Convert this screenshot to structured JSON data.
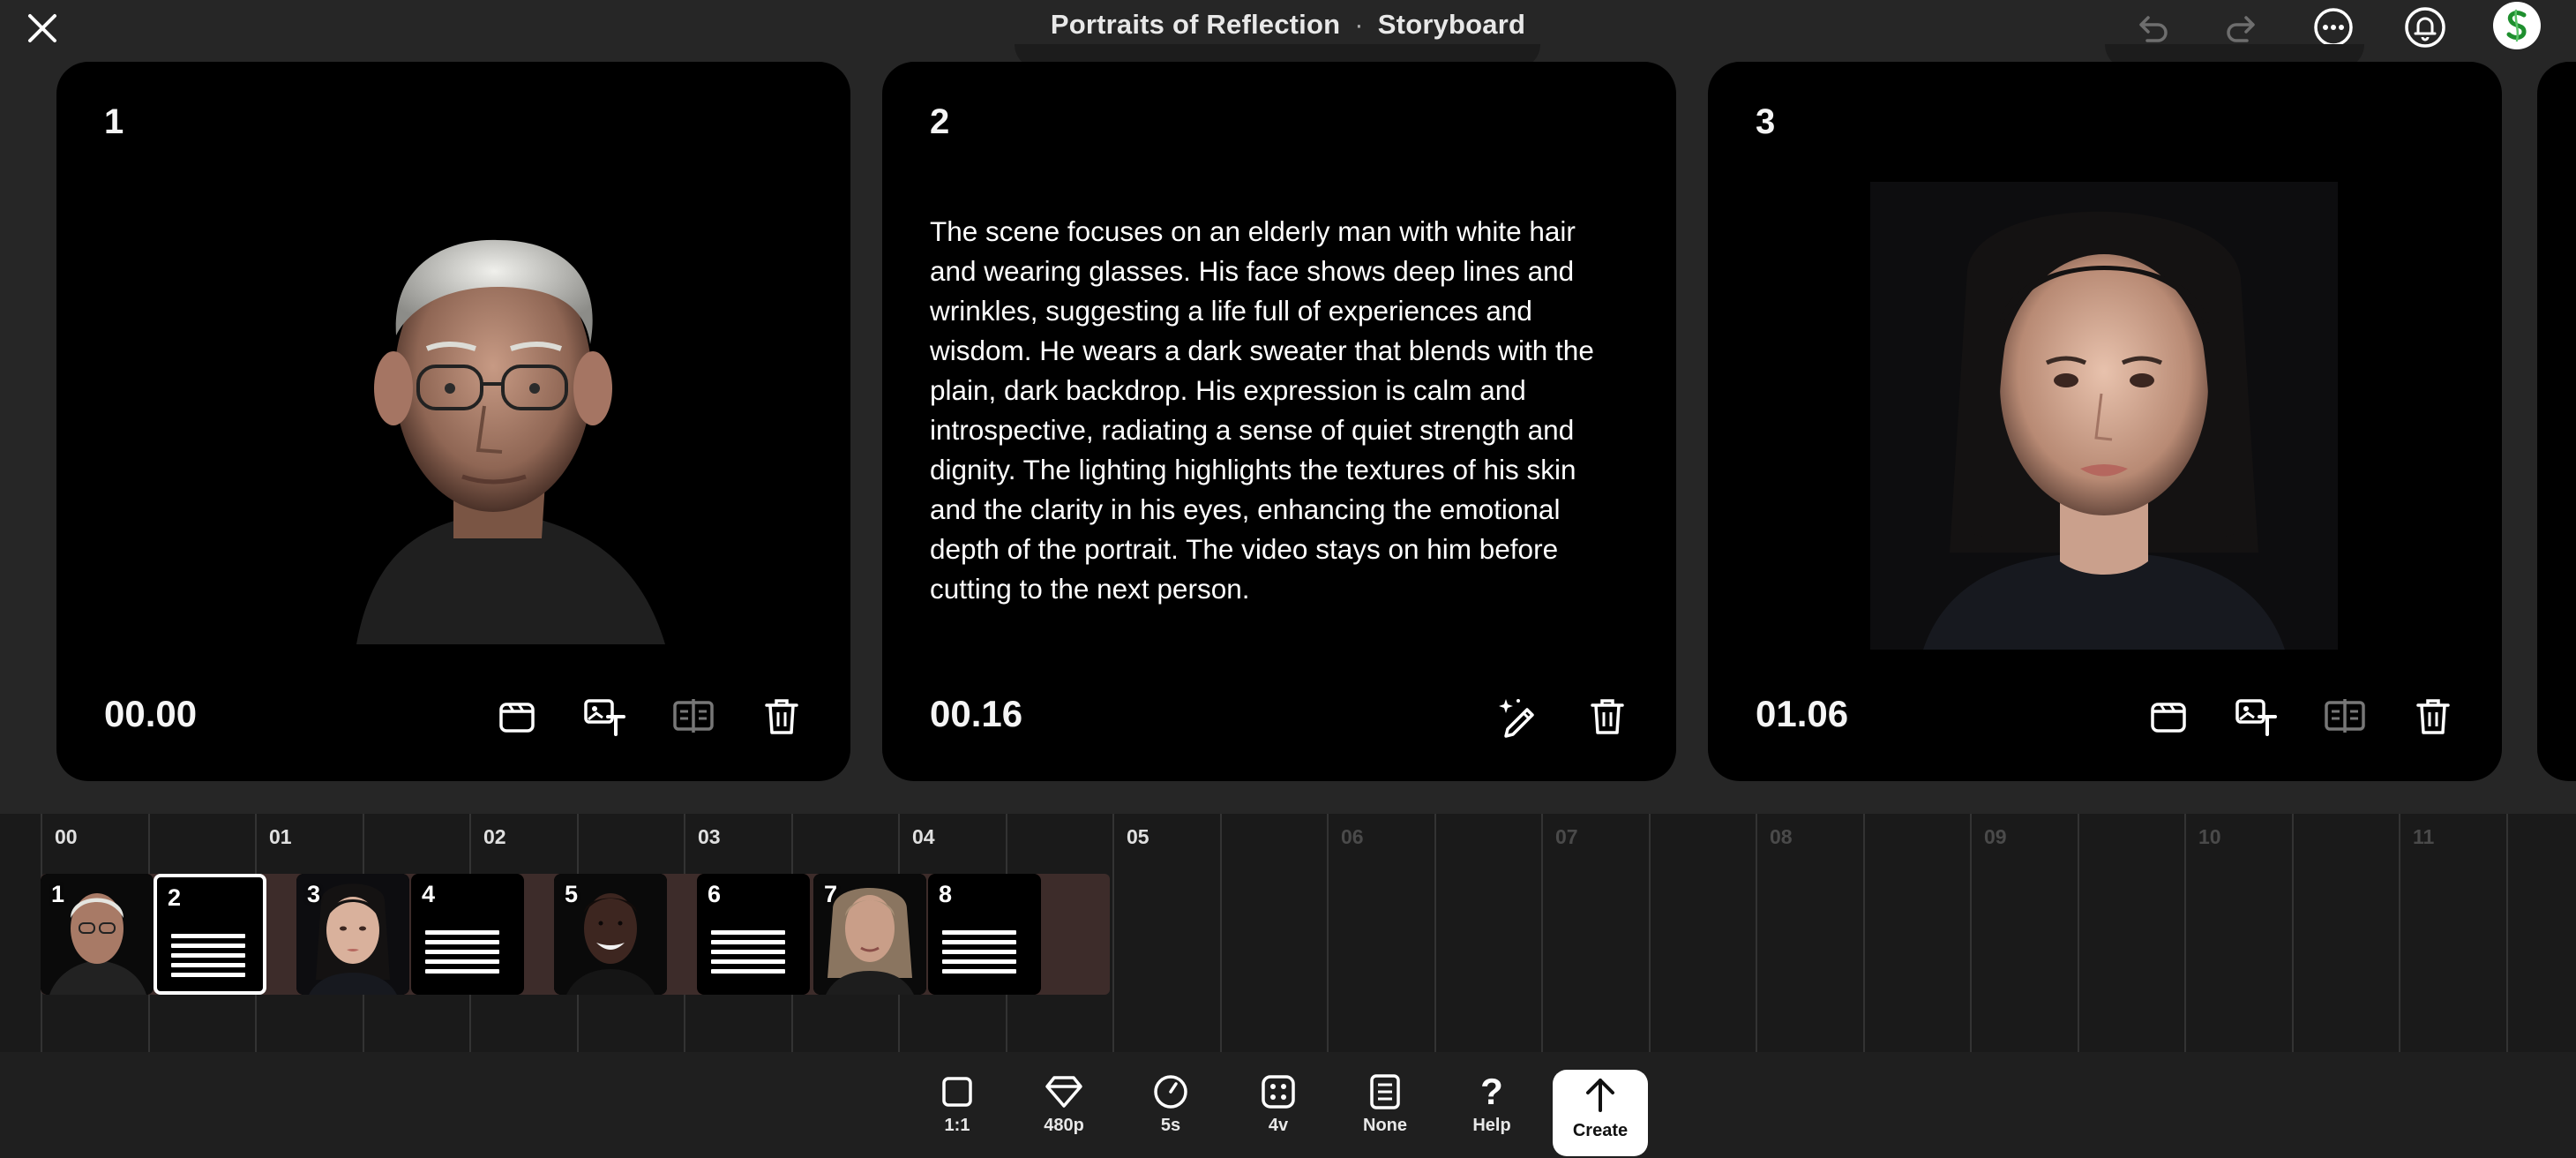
{
  "header": {
    "project_title": "Portraits of Reflection",
    "separator": "·",
    "view_title": "Storyboard"
  },
  "icons": {
    "close": "close-icon",
    "undo": "undo-icon",
    "redo": "redo-icon",
    "more": "more-icon",
    "notifications": "bell-icon",
    "avatar": "avatar-logo"
  },
  "cards": [
    {
      "number": "1",
      "kind": "image",
      "subject": "elderly-man-portrait",
      "timestamp": "00.00",
      "actions": [
        "clapper-icon",
        "image-text-icon",
        "split-icon",
        "trash-icon"
      ]
    },
    {
      "number": "2",
      "kind": "text",
      "description": "The scene focuses on an elderly man with white hair and wearing glasses. His face shows deep lines and wrinkles, suggesting a life full of experiences and wisdom. He wears a dark sweater that blends with the plain, dark backdrop. His expression is calm and introspective, radiating a sense of quiet strength and dignity. The lighting highlights the textures of his skin and the clarity in his eyes, enhancing the emotional depth of the portrait. The video stays on him before cutting to the next person.",
      "timestamp": "00.16",
      "actions": [
        "magic-pen-icon",
        "trash-icon"
      ]
    },
    {
      "number": "3",
      "kind": "image",
      "subject": "young-woman-portrait",
      "timestamp": "01.06",
      "actions": [
        "clapper-icon",
        "image-text-icon",
        "split-icon",
        "trash-icon"
      ]
    }
  ],
  "timeline": {
    "ticks": [
      "00",
      "01",
      "02",
      "03",
      "04",
      "05",
      "06",
      "07",
      "08",
      "09",
      "10",
      "11"
    ],
    "active_until": "05",
    "clips": [
      {
        "number": "1",
        "kind": "image",
        "subject": "elderly-man"
      },
      {
        "number": "2",
        "kind": "text",
        "selected": true
      },
      {
        "number": "3",
        "kind": "image",
        "subject": "young-woman"
      },
      {
        "number": "4",
        "kind": "text"
      },
      {
        "number": "5",
        "kind": "image",
        "subject": "smiling-man"
      },
      {
        "number": "6",
        "kind": "text"
      },
      {
        "number": "7",
        "kind": "image",
        "subject": "middle-aged-woman"
      },
      {
        "number": "8",
        "kind": "text"
      }
    ]
  },
  "toolbar": {
    "aspect": {
      "label": "1:1",
      "icon": "square-icon"
    },
    "quality": {
      "label": "480p",
      "icon": "diamond-icon"
    },
    "duration": {
      "label": "5s",
      "icon": "timer-icon"
    },
    "variations": {
      "label": "4v",
      "icon": "grid-icon"
    },
    "style": {
      "label": "None",
      "icon": "style-icon"
    },
    "help": {
      "label": "Help",
      "icon": "question-icon"
    },
    "create": {
      "label": "Create",
      "icon": "arrow-up-icon"
    }
  }
}
